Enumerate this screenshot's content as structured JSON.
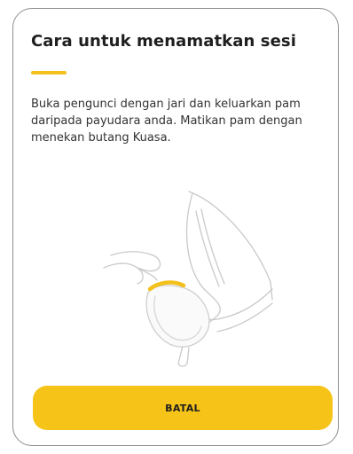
{
  "dialog": {
    "title": "Cara untuk menamatkan sesi",
    "body": "Buka pengunci dengan jari dan keluarkan pam daripada payudara anda. Matikan pam dengan menekan butang Kuasa.",
    "illustration_icon": "breast-pump-removal-illustration",
    "cancel_label": "BATAL"
  },
  "colors": {
    "accent": "#f4c01b",
    "button": "#f6c318",
    "border": "#8f8f8f",
    "text": "#1f1f1f"
  }
}
